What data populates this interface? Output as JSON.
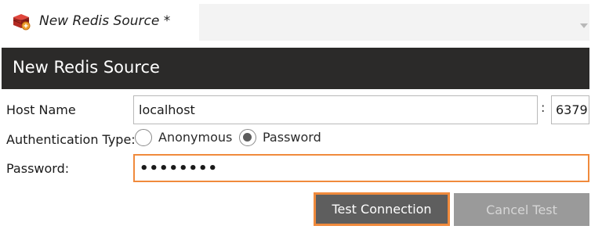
{
  "tab": {
    "icon": "redis-icon",
    "title": "New Redis Source *",
    "dropdown_value": ""
  },
  "header": {
    "title": "New Redis Source"
  },
  "form": {
    "host_label": "Host Name",
    "host_value": "localhost",
    "port_separator": ":",
    "port_value": "6379",
    "auth_label": "Authentication Type:",
    "auth_options": [
      {
        "label": "Anonymous",
        "selected": false
      },
      {
        "label": "Password",
        "selected": true
      }
    ],
    "password_label": "Password:",
    "password_value": "••••••••"
  },
  "buttons": {
    "test_connection": "Test Connection",
    "cancel_test": "Cancel Test"
  },
  "colors": {
    "accent": "#f08a3c",
    "header_bg": "#2b2a29",
    "redis_red": "#c8312b"
  }
}
